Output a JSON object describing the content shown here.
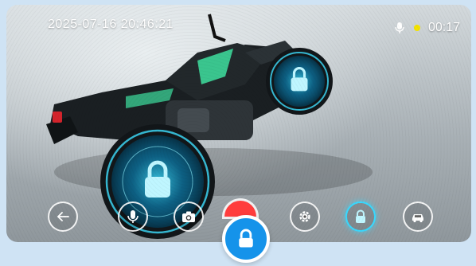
{
  "overlay": {
    "timestamp": "2025-07-16 20:46:21",
    "timer": "00:17"
  },
  "toolbar": {
    "buttons": [
      {
        "name": "back",
        "icon": "arrow-left-icon"
      },
      {
        "name": "microphone",
        "icon": "microphone-icon"
      },
      {
        "name": "camera",
        "icon": "camera-icon"
      },
      {
        "name": "record",
        "icon": "record-dot-icon"
      },
      {
        "name": "settings",
        "icon": "gear-icon"
      },
      {
        "name": "lock",
        "icon": "lock-icon"
      },
      {
        "name": "car",
        "icon": "car-icon"
      }
    ]
  },
  "floating": {
    "icon": "lock-icon"
  },
  "colors": {
    "accent": "#1593ea",
    "lock_glow": "#38d9ff",
    "record": "#ff3d3d",
    "status_dot": "#f3e200"
  }
}
